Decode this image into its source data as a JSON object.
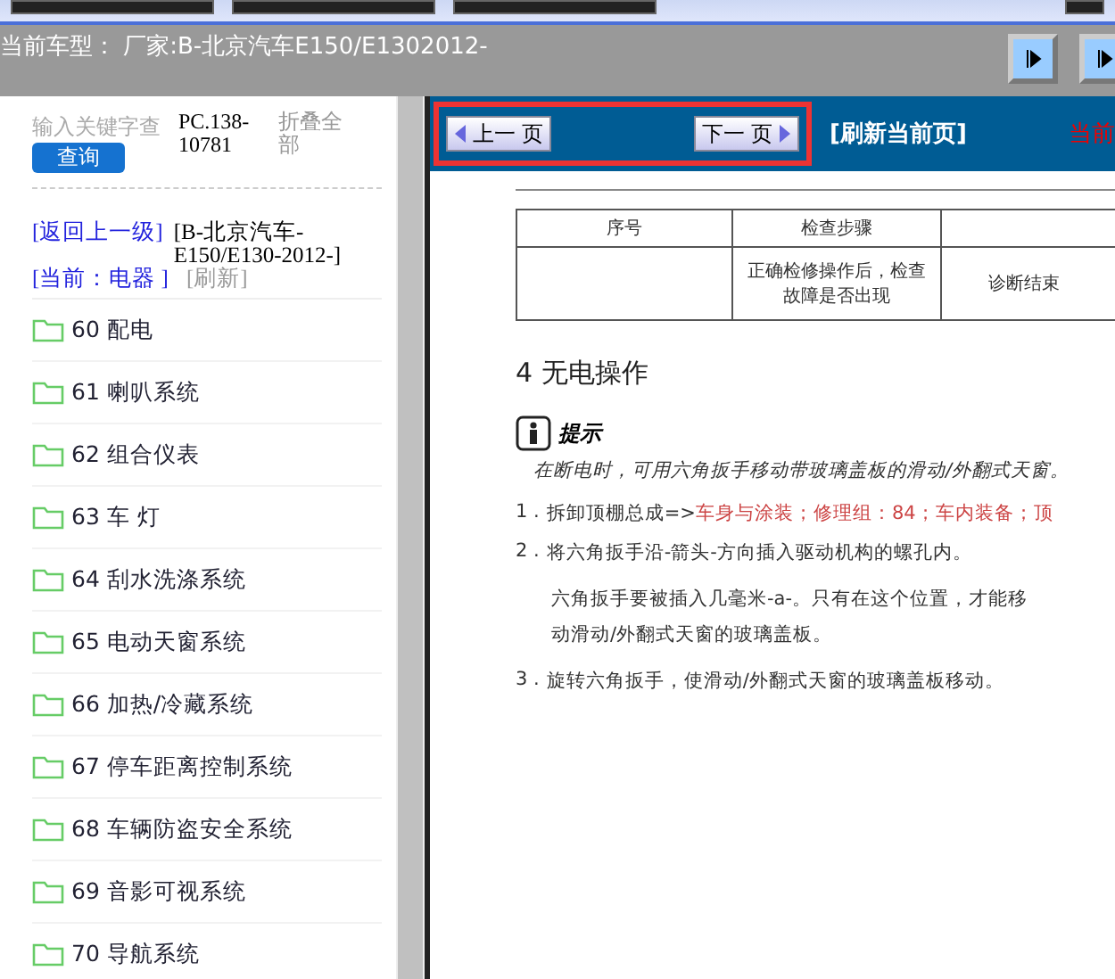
{
  "car_bar": {
    "label": "当前车型：",
    "value": "厂家:B-北京汽车E150/E1302012-"
  },
  "sidebar": {
    "search": {
      "placeholder": "输入关键字查"
    },
    "search_button": "查询",
    "code": "PC.138-10781",
    "collapse": "折叠全部",
    "back": "[返回上一级]",
    "path": "[B-北京汽车-E150/E130-2012-]",
    "current": "[当前：电器 ]",
    "refresh": "[刷新]",
    "items": [
      {
        "label": "60 配电"
      },
      {
        "label": "61 喇叭系统"
      },
      {
        "label": "62 组合仪表"
      },
      {
        "label": "63 车 灯"
      },
      {
        "label": "64 刮水洗涤系统"
      },
      {
        "label": "65 电动天窗系统"
      },
      {
        "label": "66 加热/冷藏系统"
      },
      {
        "label": "67 停车距离控制系统"
      },
      {
        "label": "68 车辆防盗安全系统"
      },
      {
        "label": "69 音影可视系统"
      },
      {
        "label": "70 导航系统"
      }
    ]
  },
  "toolbar": {
    "prev": "上一 页",
    "next": "下一 页",
    "refresh": "[刷新当前页]",
    "current": "当前"
  },
  "document": {
    "table": {
      "columns": [
        "序号",
        "检查步骤"
      ],
      "rows": [
        [
          "",
          "正确检修操作后，检查故障是否出现",
          "诊断结束"
        ]
      ]
    },
    "heading": "4 无电操作",
    "tip_title": "提示",
    "tip": "在断电时，可用六角扳手移动带玻璃盖板的滑动/外翻式天窗。",
    "steps": [
      {
        "num": "1 .",
        "text": "拆卸顶棚总成=>",
        "ref": "车身与涂装；修理组：84；车内装备；顶"
      },
      {
        "num": "2 .",
        "text": "将六角扳手沿-箭头-方向插入驱动机构的螺孔内。",
        "note": "六角扳手要被插入几毫米-a-。只有在这个位置，才能移动滑动/外翻式天窗的玻璃盖板。"
      },
      {
        "num": "3 .",
        "text": "旋转六角扳手，使滑动/外翻式天窗的玻璃盖板移动。"
      }
    ]
  }
}
